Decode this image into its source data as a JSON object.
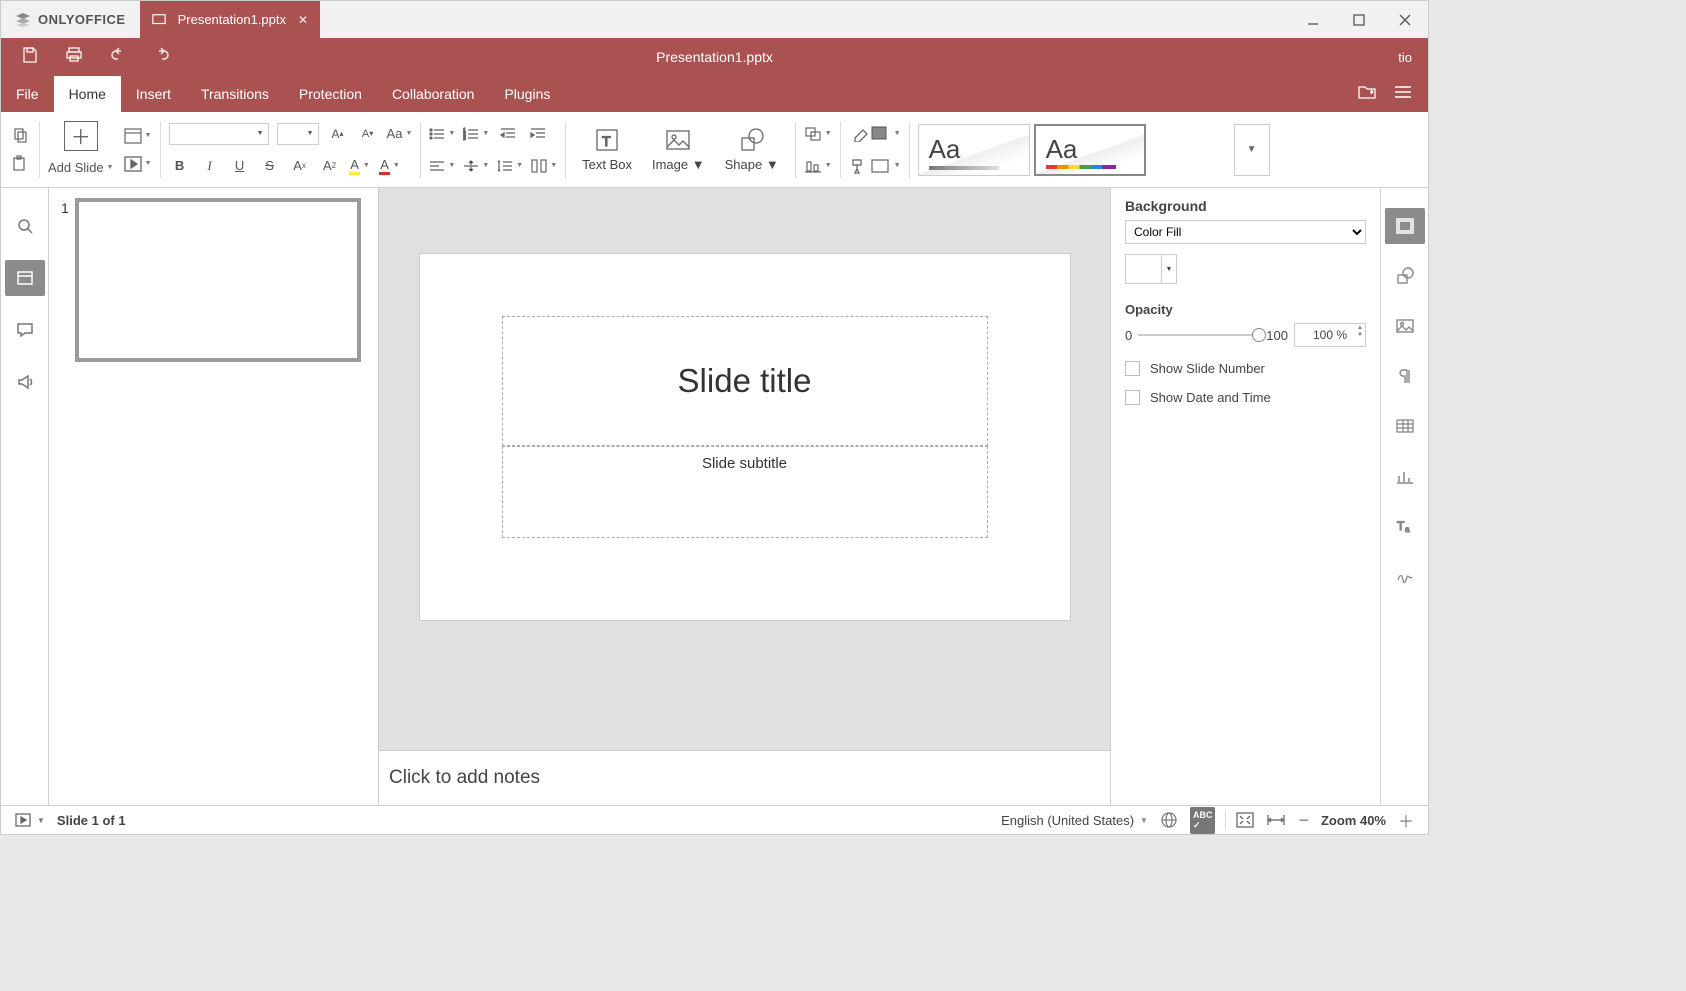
{
  "app": {
    "name": "ONLYOFFICE",
    "user": "tio"
  },
  "document": {
    "tab_title": "Presentation1.pptx",
    "title": "Presentation1.pptx"
  },
  "menu": {
    "tabs": [
      "File",
      "Home",
      "Insert",
      "Transitions",
      "Protection",
      "Collaboration",
      "Plugins"
    ],
    "active": "Home"
  },
  "ribbon": {
    "add_slide": "Add Slide",
    "text_box": "Text Box",
    "image": "Image",
    "shape": "Shape",
    "theme_label": "Aa"
  },
  "slide": {
    "number": "1",
    "title_placeholder": "Slide title",
    "subtitle_placeholder": "Slide subtitle",
    "notes_placeholder": "Click to add notes"
  },
  "rightpanel": {
    "background_label": "Background",
    "fill_type": "Color Fill",
    "opacity_label": "Opacity",
    "opacity_min": "0",
    "opacity_max": "100",
    "opacity_value": "100 %",
    "show_slide_number": "Show Slide Number",
    "show_date_time": "Show Date and Time"
  },
  "status": {
    "slide_info": "Slide 1 of 1",
    "language": "English (United States)",
    "zoom": "Zoom 40%"
  }
}
